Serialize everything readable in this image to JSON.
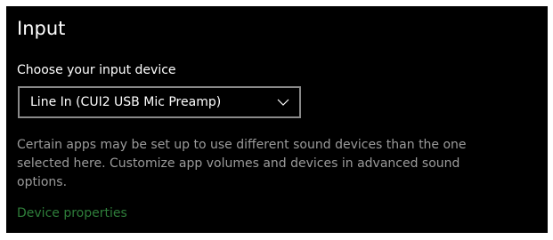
{
  "section": {
    "title": "Input",
    "choose_label": "Choose your input device",
    "device_select": {
      "value": "Line In (CUI2 USB Mic Preamp)",
      "icon": "chevron-down-icon"
    },
    "description": "Certain apps may be set up to use different sound devices than the one selected here. Customize app volumes and devices in advanced sound options.",
    "device_properties_link": "Device properties"
  },
  "colors": {
    "background": "#000000",
    "text": "#ffffff",
    "secondary_text": "#9b9b9b",
    "link": "#2e7d3a",
    "select_border": "#8a8a8a"
  }
}
